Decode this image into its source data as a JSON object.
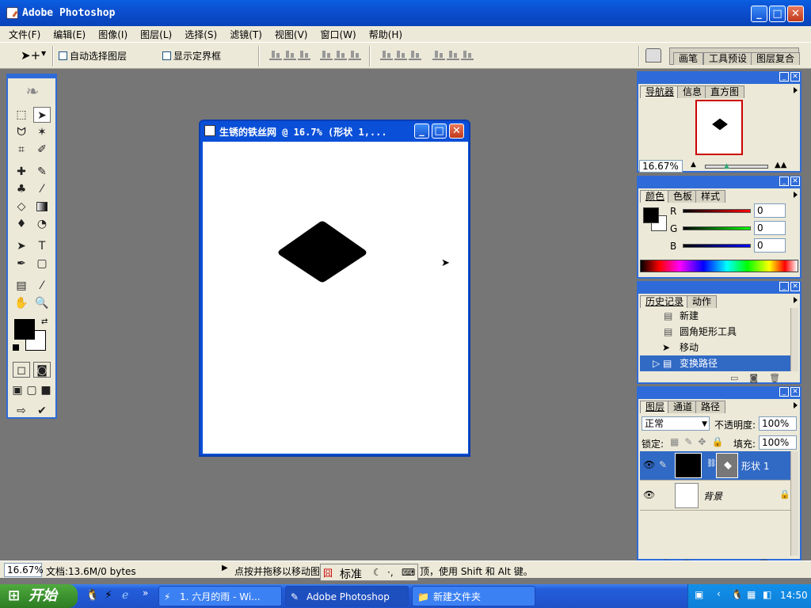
{
  "app": {
    "title": "Adobe Photoshop"
  },
  "menu": [
    "文件(F)",
    "编辑(E)",
    "图像(I)",
    "图层(L)",
    "选择(S)",
    "滤镜(T)",
    "视图(V)",
    "窗口(W)",
    "帮助(H)"
  ],
  "options": {
    "auto_select": "自动选择图层",
    "show_bounds": "显示定界框",
    "tabs": [
      "画笔",
      "工具预设",
      "图层复合"
    ]
  },
  "document": {
    "title": "生锈的铁丝网 @ 16.7% (形状 1,..."
  },
  "navigator": {
    "tabs": [
      "导航器",
      "信息",
      "直方图"
    ],
    "zoom": "16.67%"
  },
  "color": {
    "tabs": [
      "颜色",
      "色板",
      "样式"
    ],
    "r_label": "R",
    "g_label": "G",
    "b_label": "B",
    "r": "0",
    "g": "0",
    "b": "0"
  },
  "history": {
    "tabs": [
      "历史记录",
      "动作"
    ],
    "items": [
      "新建",
      "圆角矩形工具",
      "移动",
      "变换路径"
    ]
  },
  "layers": {
    "tabs": [
      "图层",
      "通道",
      "路径"
    ],
    "blend_mode": "正常",
    "opacity_label": "不透明度:",
    "opacity": "100%",
    "lock_label": "锁定:",
    "fill_label": "填充:",
    "fill": "100%",
    "items": [
      "形状 1",
      "背景"
    ]
  },
  "status": {
    "zoom": "16.67%",
    "doc": "文档:13.6M/0 bytes",
    "hint": "点按并拖移以移动图",
    "hint2": "顶，使用 Shift 和 Alt 键。"
  },
  "ime": {
    "label": "标准"
  },
  "taskbar": {
    "start": "开始",
    "tasks": [
      "1. 六月的雨 - Wi...",
      "Adobe Photoshop",
      "新建文件夹"
    ],
    "clock": "14:50"
  },
  "colors": {
    "titlebar": "#0a5fe0",
    "panel_bg": "#ece9d8",
    "workspace": "#767676",
    "selection": "#316ac5"
  }
}
